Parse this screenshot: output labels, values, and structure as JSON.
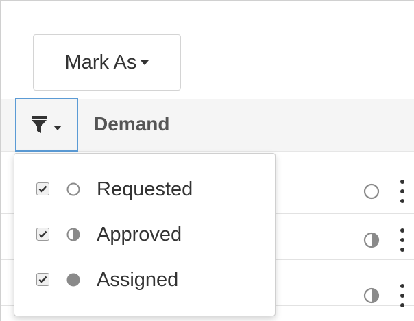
{
  "toolbar": {
    "mark_as_label": "Mark As"
  },
  "table": {
    "column_title": "Demand",
    "rows": [
      {
        "status": "requested"
      },
      {
        "status": "approved"
      },
      {
        "status": "approved"
      }
    ]
  },
  "filter_menu": {
    "items": [
      {
        "label": "Requested",
        "checked": true,
        "status_icon": "circle-outline-icon"
      },
      {
        "label": "Approved",
        "checked": true,
        "status_icon": "circle-half-icon"
      },
      {
        "label": "Assigned",
        "checked": true,
        "status_icon": "circle-filled-icon"
      }
    ]
  },
  "colors": {
    "focus_border": "#5b9bd5",
    "status_gray": "#8a8a8a",
    "header_bg": "#f5f5f5"
  }
}
